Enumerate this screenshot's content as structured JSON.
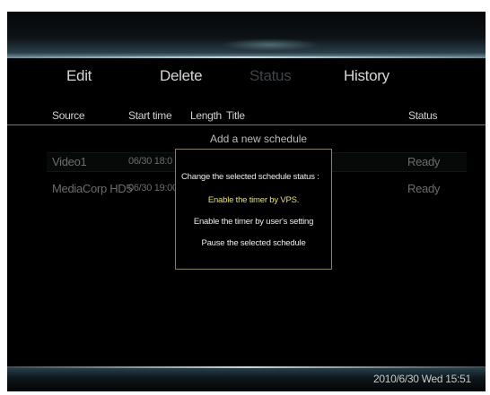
{
  "menu": {
    "edit": "Edit",
    "delete": "Delete",
    "status": "Status",
    "history": "History"
  },
  "columns": {
    "source": "Source",
    "start_time": "Start time",
    "length": "Length",
    "title": "Title",
    "status": "Status"
  },
  "add_schedule": "Add a new schedule",
  "rows": [
    {
      "source": "Video1",
      "start_time": "06/30 18:0",
      "status": "Ready"
    },
    {
      "source": "MediaCorp HD5",
      "start_time": "06/30 19:00",
      "status": "Ready"
    }
  ],
  "dialog": {
    "title": "Change the selected schedule status :",
    "options": [
      "Enable the timer by VPS.",
      "Enable the timer by user's setting",
      "Pause the selected schedule"
    ],
    "selected_index": 0
  },
  "datetime": "2010/6/30 Wed 15:51",
  "colors": {
    "background": "#000000",
    "text_primary": "#d6d6d6",
    "text_dim": "#6c6c6c",
    "highlight": "#e8e060",
    "accent_glow": "#7c9aa6",
    "dialog_border": "#8a8060"
  }
}
